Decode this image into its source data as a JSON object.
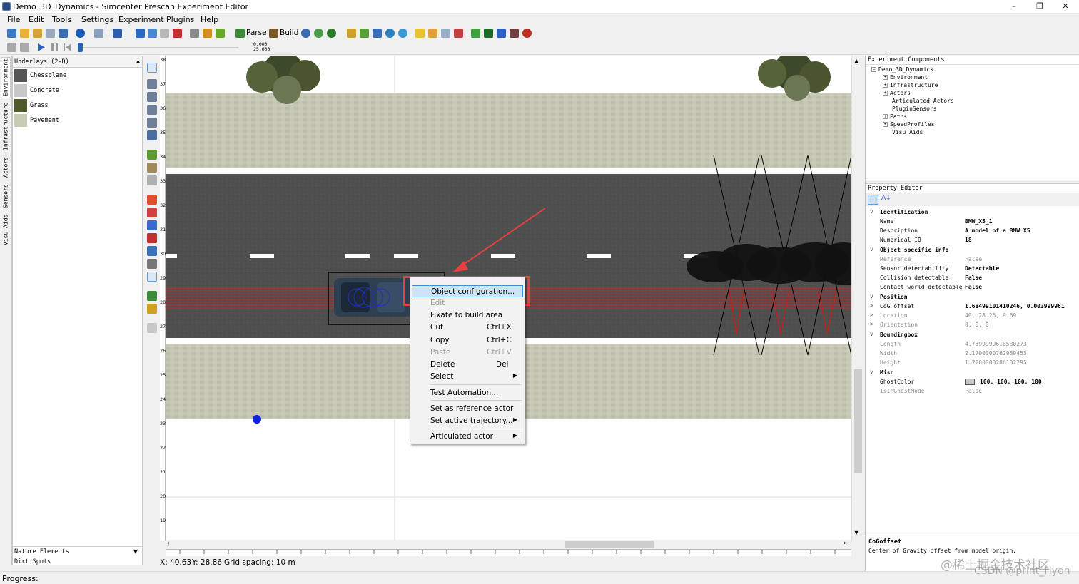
{
  "window": {
    "title": "Demo_3D_Dynamics - Simcenter Prescan Experiment Editor",
    "minimize_glyph": "–",
    "maximize_glyph": "❐",
    "close_glyph": "✕"
  },
  "menubar": [
    "File",
    "Edit",
    "Tools",
    "Settings",
    "Experiment",
    "Plugins",
    "Help"
  ],
  "toolbar": {
    "parse_label": "Parse",
    "build_label": "Build",
    "counter_top": "0.000",
    "counter_bottom": "25.600"
  },
  "side_tabs": [
    "Environment",
    "Infrastructure",
    "Actors",
    "Sensors",
    "Visu Aids"
  ],
  "library": {
    "header": "Underlays (2-D)",
    "items": [
      {
        "label": "Chessplane",
        "color": "#555555"
      },
      {
        "label": "Concrete",
        "color": "#c8c8c8"
      },
      {
        "label": "Grass",
        "color": "#4f5a2a"
      },
      {
        "label": "Pavement",
        "color": "#c9cbb4"
      }
    ],
    "bottom_header": "Nature Elements",
    "bottom_item": "Dirt Spots"
  },
  "ruler": {
    "vertical_ticks": [
      "38",
      "37",
      "36",
      "35",
      "34",
      "33",
      "32",
      "31",
      "30",
      "29",
      "28",
      "27",
      "26",
      "25",
      "24",
      "23",
      "22",
      "21",
      "20",
      "19"
    ]
  },
  "canvas": {
    "colors": {
      "road": "#505050",
      "pavement": "#c6c6b4",
      "sensor_cone": "#e02020",
      "marker": "#1020e0"
    }
  },
  "status": {
    "x": "X: 40.63",
    "y": "Y: 28.86",
    "grid": "Grid spacing: 10 m",
    "progress_label": "Progress:"
  },
  "context_menu": [
    {
      "label": "Object configuration...",
      "shortcut": "",
      "submenu": false,
      "enabled": true,
      "highlighted": true
    },
    {
      "label": "Edit",
      "shortcut": "",
      "submenu": false,
      "enabled": false,
      "highlighted": false
    },
    {
      "label": "Fixate to build area",
      "shortcut": "",
      "submenu": false,
      "enabled": true,
      "highlighted": false
    },
    {
      "label": "Cut",
      "shortcut": "Ctrl+X",
      "submenu": false,
      "enabled": true,
      "highlighted": false
    },
    {
      "label": "Copy",
      "shortcut": "Ctrl+C",
      "submenu": false,
      "enabled": true,
      "highlighted": false
    },
    {
      "label": "Paste",
      "shortcut": "Ctrl+V",
      "submenu": false,
      "enabled": false,
      "highlighted": false
    },
    {
      "label": "Delete",
      "shortcut": "Del",
      "submenu": false,
      "enabled": true,
      "highlighted": false
    },
    {
      "label": "Select",
      "shortcut": "",
      "submenu": true,
      "enabled": true,
      "highlighted": false
    },
    {
      "label": "Test Automation...",
      "shortcut": "",
      "submenu": false,
      "enabled": true,
      "highlighted": false
    },
    {
      "label": "Set as reference actor",
      "shortcut": "",
      "submenu": false,
      "enabled": true,
      "highlighted": false
    },
    {
      "label": "Set active trajectory...",
      "shortcut": "",
      "submenu": true,
      "enabled": true,
      "highlighted": false
    },
    {
      "label": "Articulated actor",
      "shortcut": "",
      "submenu": true,
      "enabled": true,
      "highlighted": false
    }
  ],
  "experiment_components": {
    "header": "Experiment Components",
    "root": "Demo_3D_Dynamics",
    "children": [
      {
        "label": "Environment",
        "expandable": true
      },
      {
        "label": "Infrastructure",
        "expandable": true
      },
      {
        "label": "Actors",
        "expandable": true
      },
      {
        "label": "Articulated Actors",
        "expandable": false
      },
      {
        "label": "PluginSensors",
        "expandable": false
      },
      {
        "label": "Paths",
        "expandable": true
      },
      {
        "label": "SpeedProfiles",
        "expandable": true
      },
      {
        "label": "Visu Aids",
        "expandable": false
      }
    ]
  },
  "property_editor": {
    "header": "Property Editor",
    "rows": [
      {
        "kind": "cat",
        "key": "Identification"
      },
      {
        "kind": "prop",
        "key": "Name",
        "value": "BMW_X5_1",
        "bold": true
      },
      {
        "kind": "prop",
        "key": "Description",
        "value": "A model of a BMW X5",
        "bold": true
      },
      {
        "kind": "prop",
        "key": "Numerical ID",
        "value": "18",
        "bold": true
      },
      {
        "kind": "cat",
        "key": "Object specific info"
      },
      {
        "kind": "prop",
        "key": "Reference",
        "value": "False",
        "bold": false,
        "gray": true
      },
      {
        "kind": "prop",
        "key": "Sensor detectability",
        "value": "Detectable",
        "bold": true
      },
      {
        "kind": "prop",
        "key": "Collision detectable",
        "value": "False",
        "bold": true
      },
      {
        "kind": "prop",
        "key": "Contact world detectable",
        "value": "False",
        "bold": true
      },
      {
        "kind": "cat",
        "key": "Position"
      },
      {
        "kind": "sub",
        "key": "CoG offset",
        "value": "1.68499101410246, 0.003999961",
        "bold": true
      },
      {
        "kind": "sub",
        "key": "Location",
        "value": "40, 28.25, 0.69",
        "bold": false,
        "gray": true
      },
      {
        "kind": "sub",
        "key": "Orientation",
        "value": "0, 0, 0",
        "bold": false,
        "gray": true
      },
      {
        "kind": "cat",
        "key": "Boundingbox"
      },
      {
        "kind": "prop",
        "key": "Length",
        "value": "4.7899999618530273",
        "bold": false,
        "gray": true
      },
      {
        "kind": "prop",
        "key": "Width",
        "value": "2.1700000762939453",
        "bold": false,
        "gray": true
      },
      {
        "kind": "prop",
        "key": "Height",
        "value": "1.7200000286102295",
        "bold": false,
        "gray": true
      },
      {
        "kind": "cat",
        "key": "Misc"
      },
      {
        "kind": "color",
        "key": "GhostColor",
        "value": "100, 100, 100, 100",
        "bold": true
      },
      {
        "kind": "prop",
        "key": "IsInGhostMode",
        "value": "False",
        "bold": false,
        "gray": true
      }
    ],
    "footer_title": "CoGoffset",
    "footer_desc": "Center of Gravity offset from model origin."
  },
  "watermark": {
    "line1": "@稀土掘金技术社区",
    "line2": "CSDN @print_Hyon"
  }
}
